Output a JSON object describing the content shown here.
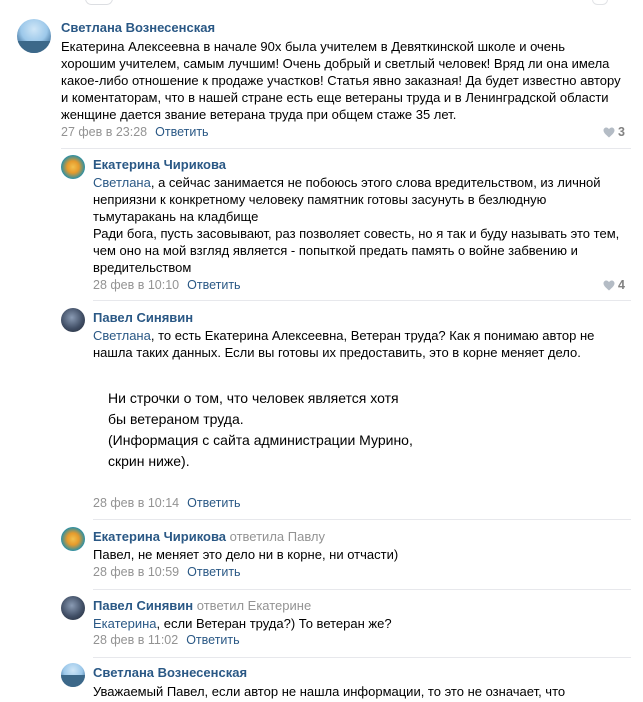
{
  "comments": [
    {
      "author": "Светлана Вознесенская",
      "text": "Екатерина Алексеевна в начале 90х была учителем в Девяткинской школе и очень хорошим учителем, самым лучшим! Очень добрый и светлый человек! Вряд ли она имела какое-либо отношение к продаже участков! Статья явно заказная! Да будет известно автору и коментаторам, что в нашей стране есть еще ветераны труда и в Ленинградской области женщине дается звание ветерана труда при общем стаже 35 лет.",
      "date": "27 фев в 23:28",
      "reply": "Ответить",
      "likes": "3"
    },
    {
      "author": "Екатерина Чирикова",
      "mention": "Светлана",
      "text1": ", а сейчас занимается не побоюсь этого слова вредительством, из личной неприязни к конкретному человеку памятник готовы засунуть в безлюдную тьмутаракань на кладбище",
      "text2": "Ради бога, пусть засовывают, раз позволяет совесть, но я так и буду называть это тем, чем оно на мой взгляд является - попыткой предать память о войне забвению и вредительством",
      "date": "28 фев в 10:10",
      "reply": "Ответить",
      "likes": "4"
    },
    {
      "author": "Павел Синявин",
      "mention": "Светлана",
      "text": ", то есть Екатерина Алексеевна, Ветеран труда? Как я понимаю автор не нашла таких данных. Если вы готовы их предоставить, это в корне меняет дело.",
      "quote": "Ни строчки о том, что человек является хотя\nбы ветераном труда.\n(Информация с сайта администрации Мурино,\nскрин ниже).",
      "date": "28 фев в 10:14",
      "reply": "Ответить"
    },
    {
      "author": "Екатерина Чирикова",
      "author_suffix": "ответила Павлу",
      "text": "Павел, не меняет это дело ни в корне, ни отчасти)",
      "date": "28 фев в 10:59",
      "reply": "Ответить"
    },
    {
      "author": "Павел Синявин",
      "author_suffix": "ответил Екатерине",
      "mention": "Екатерина",
      "text": ", если Ветеран труда?) То ветеран же?",
      "date": "28 фев в 11:02",
      "reply": "Ответить"
    },
    {
      "author": "Светлана Вознесенская",
      "text": "Уважаемый Павел, если автор не нашла информации, то это не означает, что"
    }
  ],
  "icons": {
    "like": "heart-icon"
  },
  "colors": {
    "link": "#2a5885",
    "meta": "#939393",
    "divider": "#e7e8ec"
  }
}
